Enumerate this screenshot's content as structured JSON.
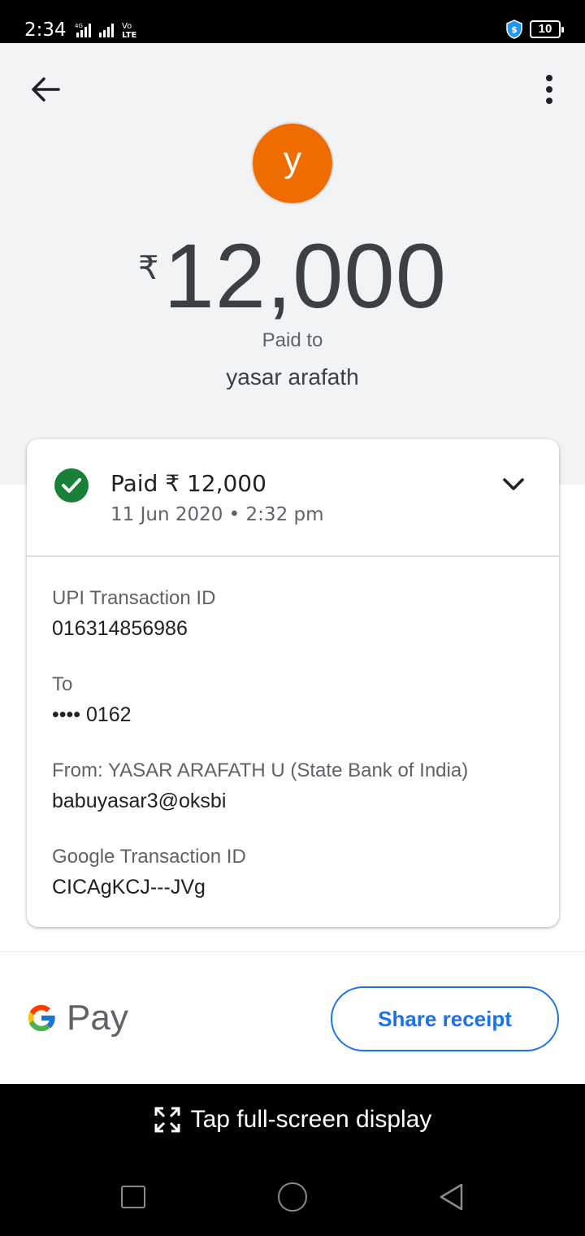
{
  "status_bar": {
    "time": "2:34",
    "battery": "10"
  },
  "header": {
    "avatar_letter": "y",
    "currency_symbol": "₹",
    "amount": "12,000",
    "paid_to_label": "Paid to",
    "payee_name": "yasar arafath",
    "avatar_color": "#ef6c00"
  },
  "summary": {
    "title": "Paid ₹ 12,000",
    "date": "11 Jun 2020 • 2:32 pm",
    "status_color": "#188038"
  },
  "details": [
    {
      "label": "UPI Transaction ID",
      "value": "016314856986"
    },
    {
      "label": "To",
      "value": "•••• 0162"
    },
    {
      "label": "From: YASAR ARAFATH  U (State Bank of India)",
      "value": "babuyasar3@oksbi"
    },
    {
      "label": "Google Transaction ID",
      "value": "CICAgKCJ---JVg"
    }
  ],
  "footer": {
    "brand": "Pay",
    "share_label": "Share receipt",
    "accent_color": "#1a73e8"
  },
  "system": {
    "fullscreen_hint": "Tap full-screen display"
  }
}
